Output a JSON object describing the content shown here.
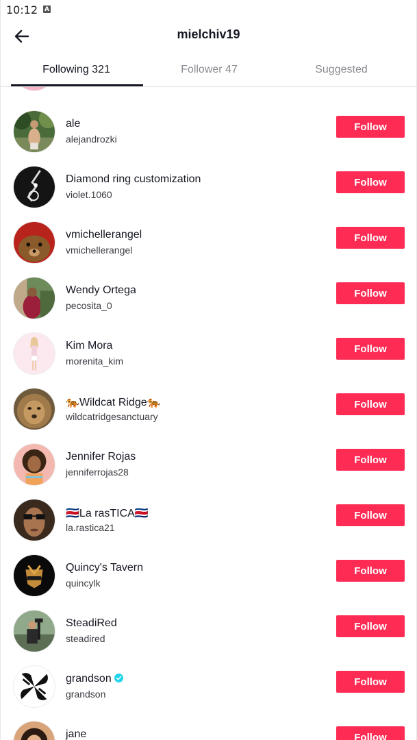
{
  "status_bar": {
    "time": "10:12",
    "notification_icon": "a-icon"
  },
  "header": {
    "back_icon": "back-arrow-icon",
    "title": "mielchiv19"
  },
  "tabs": [
    {
      "label": "Following 321",
      "active": true
    },
    {
      "label": "Follower 47",
      "active": false
    },
    {
      "label": "Suggested",
      "active": false
    }
  ],
  "colors": {
    "accent": "#fe2c55",
    "text_primary": "#161823",
    "text_secondary": "#8a8b91",
    "verified": "#20d5ec"
  },
  "users": [
    {
      "name": "ale",
      "handle": "alejandrozki",
      "button": "Follow"
    },
    {
      "name": "Diamond ring customization",
      "handle": "violet.1060",
      "button": "Follow"
    },
    {
      "name": "vmichellerangel",
      "handle": "vmichellerangel",
      "button": "Follow"
    },
    {
      "name": "Wendy Ortega",
      "handle": "pecosita_0",
      "button": "Follow"
    },
    {
      "name": "Kim Mora",
      "handle": "morenita_kim",
      "button": "Follow"
    },
    {
      "name": "🐅Wildcat Ridge🐅",
      "handle": "wildcatridgesanctuary",
      "button": "Follow"
    },
    {
      "name": "Jennifer Rojas",
      "handle": "jenniferrojas28",
      "button": "Follow"
    },
    {
      "name": "🇨🇷La rasTICA🇨🇷",
      "handle": "la.rastica21",
      "button": "Follow"
    },
    {
      "name": "Quincy's Tavern",
      "handle": "quincylk",
      "button": "Follow"
    },
    {
      "name": "SteadiRed",
      "handle": "steadired",
      "button": "Follow"
    },
    {
      "name": "grandson",
      "handle": "grandson",
      "button": "Follow",
      "verified": true
    },
    {
      "name": "jane",
      "handle": "",
      "button": "Follow"
    }
  ]
}
